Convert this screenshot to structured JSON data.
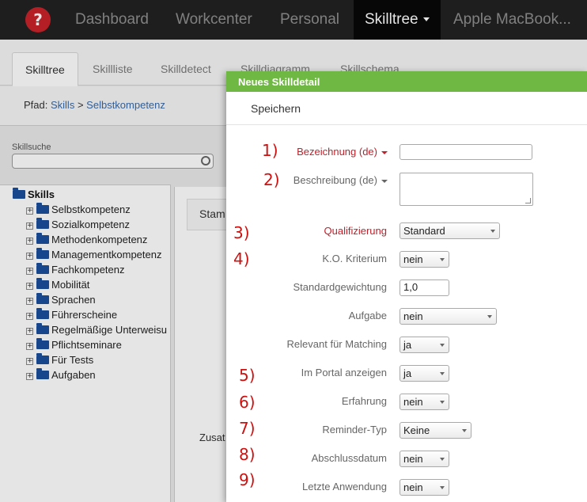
{
  "navbar": {
    "logo_glyph": "?",
    "items": [
      "Dashboard",
      "Workcenter",
      "Personal",
      "Skilltree",
      "Apple MacBook..."
    ],
    "active_index": 3
  },
  "tabs": [
    "Skilltree",
    "Skillliste",
    "Skilldetect",
    "Skilldiagramm",
    "Skillschema"
  ],
  "breadcrumb": {
    "prefix": "Pfad:",
    "link1": "Skills",
    "separator": ">",
    "link2": "Selbstkompetenz"
  },
  "skill_search": {
    "label": "Skillsuche",
    "value": ""
  },
  "tree": {
    "root": "Skills",
    "items": [
      "Selbstkompetenz",
      "Sozialkompetenz",
      "Methodenkompetenz",
      "Managementkompetenz",
      "Fachkompetenz",
      "Mobilität",
      "Sprachen",
      "Führerscheine",
      "Regelmäßige Unterweisu",
      "Pflichtseminare",
      "Für Tests",
      "Aufgaben"
    ]
  },
  "background_panel": {
    "header": "Stam",
    "footer_text": "Zusat"
  },
  "modal": {
    "title": "Neues Skilldetail",
    "save_label": "Speichern",
    "fields": {
      "bezeichnung": {
        "number": "1)",
        "label": "Bezeichnung (de)",
        "value": ""
      },
      "beschreibung": {
        "number": "2)",
        "label": "Beschreibung (de)",
        "value": ""
      },
      "qualifizierung": {
        "number": "3)",
        "label": "Qualifizierung",
        "value": "Standard"
      },
      "ko_kriterium": {
        "number": "4)",
        "label": "K.O. Kriterium",
        "value": "nein"
      },
      "standardgewichtung": {
        "label": "Standardgewichtung",
        "value": "1,0"
      },
      "aufgabe": {
        "label": "Aufgabe",
        "value": "nein"
      },
      "relevant_matching": {
        "label": "Relevant für Matching",
        "value": "ja"
      },
      "im_portal": {
        "number": "5)",
        "label": "Im Portal anzeigen",
        "value": "ja"
      },
      "erfahrung": {
        "number": "6)",
        "label": "Erfahrung",
        "value": "nein"
      },
      "reminder_typ": {
        "number": "7)",
        "label": "Reminder-Typ",
        "value": "Keine"
      },
      "abschlussdatum": {
        "number": "8)",
        "label": "Abschlussdatum",
        "value": "nein"
      },
      "letzte_anwendung": {
        "number": "9)",
        "label": "Letzte Anwendung",
        "value": "nein"
      }
    }
  },
  "colors": {
    "navbar": "#222222",
    "modal_header": "#6fb843",
    "required_label": "#c0202a",
    "annotation_number": "#cc1111",
    "link": "#3a6aa6"
  }
}
